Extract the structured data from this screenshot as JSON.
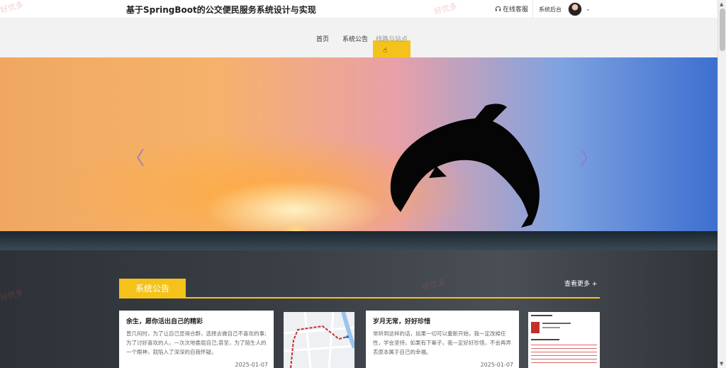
{
  "header": {
    "title": "基于SpringBoot的公交便民服务系统设计与实现",
    "customer_service": "在线客服",
    "admin": "系统后台"
  },
  "nav": {
    "items": [
      {
        "label": "首页"
      },
      {
        "label": "系统公告"
      },
      {
        "label": "线路与站点"
      }
    ],
    "active_index": 2
  },
  "banner": {
    "prev_icon": "chevron-left-icon",
    "next_icon": "chevron-right-icon"
  },
  "notice": {
    "section_title": "系统公告",
    "more": "查看更多 +",
    "cards": [
      {
        "title": "余生，愿你活出自己的精彩",
        "body": "曾几何时，为了让自己显得合群，选择去做自己不喜欢的事;为了讨好喜欢的人，一次次地委屈自己;甚至，为了陌生人的一个眼神，就陷入了深深的自我怀疑。",
        "date": "2025-01-07"
      },
      {
        "title": "岁月无常，好好珍惜",
        "body": "常听到这样的话，如果一切可以重新开始，我一定改掉任性，学会坚持，如果有下辈子，我一定好好珍惜，不会再弄丢原本属于自己的幸福。",
        "date": "2025-01-07"
      }
    ]
  },
  "watermark": "好优多",
  "colors": {
    "accent": "#f5c21b",
    "nav_bg": "#f2f2f2"
  }
}
